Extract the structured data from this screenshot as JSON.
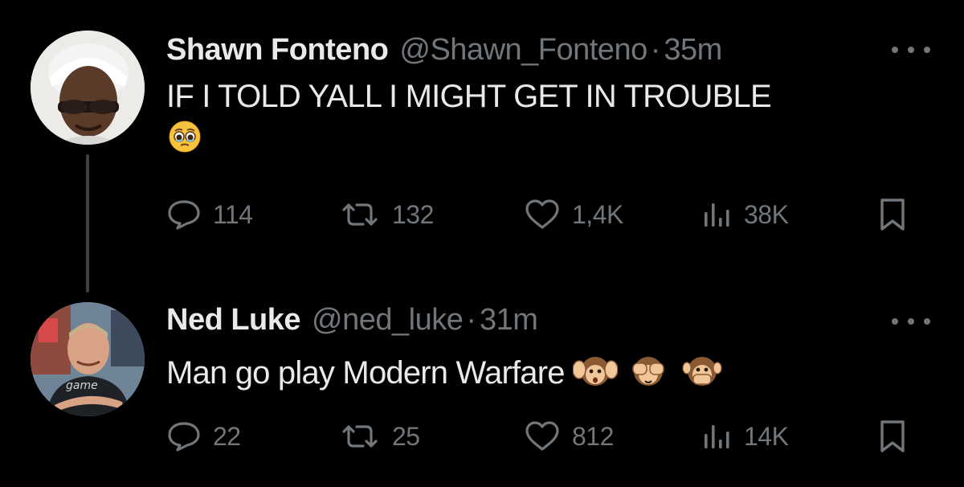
{
  "tweets": [
    {
      "name": "Shawn Fonteno",
      "handle": "@Shawn_Fonteno",
      "separator": "·",
      "time": "35m",
      "text": "IF I TOLD YALL I MIGHT GET IN TROUBLE",
      "emojis": [
        "face-holding-back-tears"
      ],
      "replies": "114",
      "retweets": "132",
      "likes": "1,4K",
      "views": "38K"
    },
    {
      "name": "Ned Luke",
      "handle": "@ned_luke",
      "separator": "·",
      "time": "31m",
      "text": "Man go play Modern Warfare",
      "emojis": [
        "hear-no-evil-monkey",
        "see-no-evil-monkey",
        "speak-no-evil-monkey"
      ],
      "replies": "22",
      "retweets": "25",
      "likes": "812",
      "views": "14K"
    }
  ],
  "icons": {
    "reply": "reply-icon",
    "retweet": "retweet-icon",
    "like": "heart-icon",
    "views": "views-icon",
    "bookmark": "bookmark-icon",
    "more": "more-icon"
  },
  "colors": {
    "background": "#000000",
    "primary_text": "#e7e9ea",
    "secondary_text": "#71767b",
    "thread_line": "#3e4144"
  }
}
